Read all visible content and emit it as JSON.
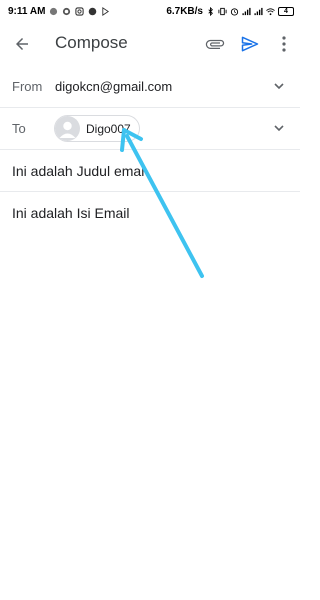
{
  "status_bar": {
    "time": "9:11 AM",
    "net_speed": "6.7KB/s",
    "battery_level": "4"
  },
  "app_bar": {
    "title": "Compose",
    "icons": {
      "back": "arrow-left-icon",
      "attach": "paperclip-icon",
      "send": "send-icon",
      "more": "more-vert-icon"
    },
    "send_color": "#1a73e8"
  },
  "compose": {
    "from_label": "From",
    "from_value": "digokcn@gmail.com",
    "to_label": "To",
    "recipient_chip": "Digo007",
    "subject": "Ini adalah Judul email",
    "body": "Ini adalah Isi Email"
  },
  "annotation": {
    "arrow_color": "#3ec3f0",
    "points_to": "recipient_chip"
  }
}
